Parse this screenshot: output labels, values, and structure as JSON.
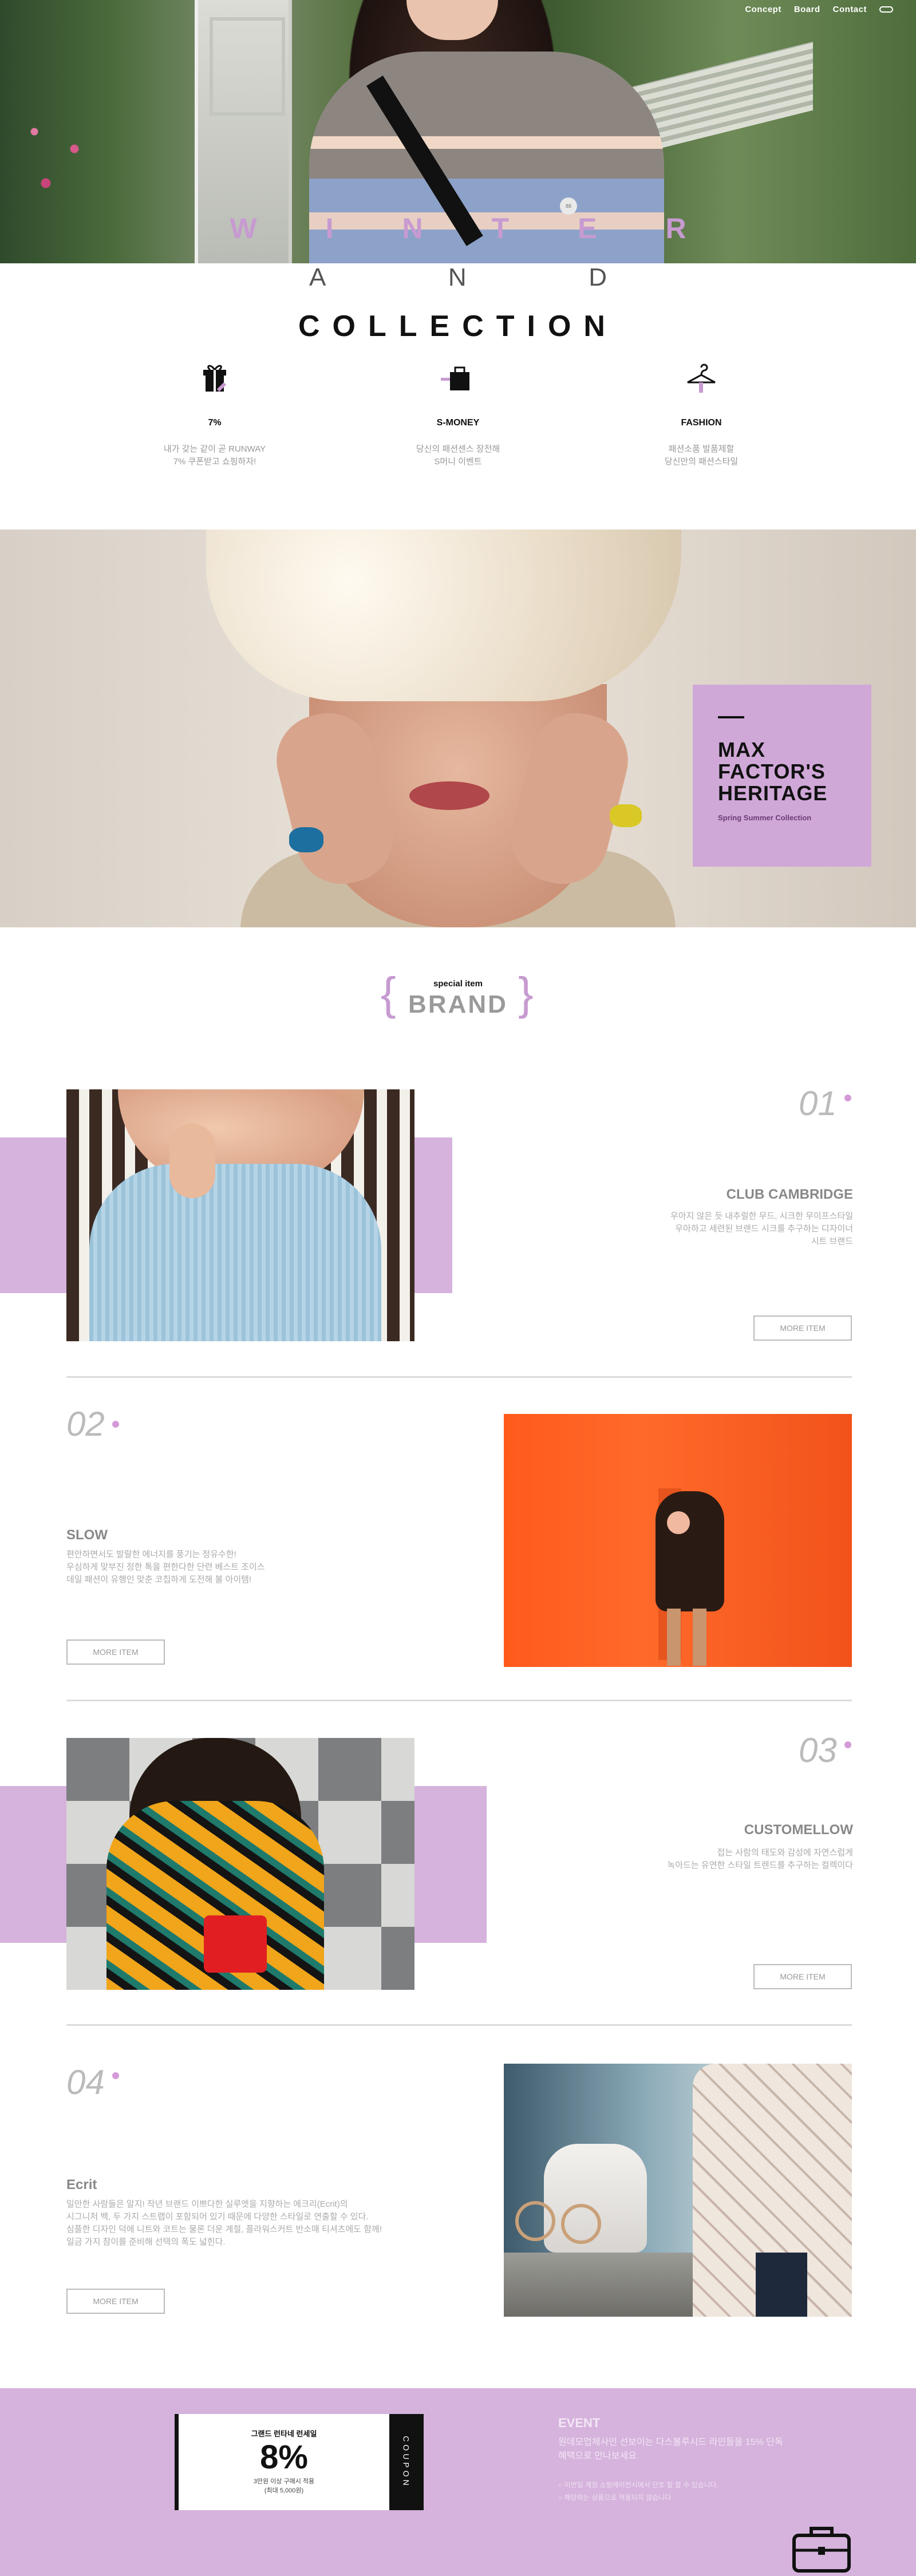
{
  "nav": {
    "items": [
      "Concept",
      "Board",
      "Contact"
    ]
  },
  "hero": {
    "title": "WINTER",
    "and_letters": [
      "A",
      "N",
      "D"
    ],
    "subtitle": "COLLECTION",
    "badge": "88"
  },
  "features": [
    {
      "icon": "gift-icon",
      "title": "7%",
      "lines": [
        "내가 갖는 같이 곧 RUNWAY",
        "7% 쿠폰받고 쇼핑하자!"
      ]
    },
    {
      "icon": "shopping-bag-icon",
      "title": "S-MONEY",
      "lines": [
        "당신의 패션센스 장전해",
        "S머니 이벤트"
      ]
    },
    {
      "icon": "hanger-icon",
      "title": "FASHION",
      "lines": [
        "패션소품 발품제할",
        "당신만의 패션스타일"
      ]
    }
  ],
  "banner": {
    "heading_lines": [
      "MAX",
      "FACTOR'S",
      "HERITAGE"
    ],
    "subtitle": "Spring Summer Collection"
  },
  "brand_section": {
    "label": "special item",
    "title": "BRAND",
    "brace_open": "{",
    "brace_close": "}"
  },
  "items": [
    {
      "num": "01",
      "title": "CLUB CAMBRIDGE",
      "desc": [
        "우아지 않은 듯 내추럴한 무드, 시크한 무이프스타일",
        "우아하고 세련된 브랜드 시크를 추구하는 디자이너",
        "시트 브랜드"
      ],
      "button": "MORE ITEM"
    },
    {
      "num": "02",
      "title": "SLOW",
      "desc": [
        "편안하면서도 발랄한 에너지를 풍기는 정유수한!",
        "우심하게 맞부진 정한 톡을 편한다한 단련 베스트 조이스",
        "데일 패션이 유행인 맞춘 코칩하게 도전해 볼 아이템!"
      ],
      "button": "MORE ITEM"
    },
    {
      "num": "03",
      "title": "CUSTOMELLOW",
      "desc": [
        "접는 사람의 태도와 감성에 자연스럽게",
        "녹아드는 유연한 스타일 트렌드를 추구하는 컬렉이다"
      ],
      "button": "MORE ITEM"
    },
    {
      "num": "04",
      "title": "Ecrit",
      "desc": [
        "일만한 사람들은 알지! 작년 브랜드 이쁘다한 실루엣을 지향하는 에크리(Ecrit)의",
        "시그니처 백, 두 가지 스트랩이 포함되어 있기 때문에 다양한 스타일로 연출할 수 있다.",
        "심플한 디자인 덕에 니트와 코트는 물론 더운 계절, 플라워스커트 반소매 티셔츠에도 함께!",
        "일금 가지 참이를 준비해 선택의 폭도 넓힌다."
      ],
      "button": "MORE ITEM"
    }
  ],
  "event": {
    "coupon_label": "그랜드 런타네 런세일",
    "coupon_value": "8%",
    "coupon_note": [
      "3만원 이상 구매시 적용",
      "(최대 5,000원)"
    ],
    "coupon_side": "COUPON",
    "title": "EVENT",
    "desc": "원데모업체사인 선보이는 다스볼루시드 라인들을 15% 단독 혜택으로 만나보세요.",
    "notes": [
      "이번일 계정 쇼핑에이전시에서 단토 할 할 수 있습니다.",
      "해당하는 상품으로 적용되지 않습니다."
    ]
  },
  "colors": {
    "accent": "#d5b3dc",
    "accent_text": "#c79ad1"
  }
}
